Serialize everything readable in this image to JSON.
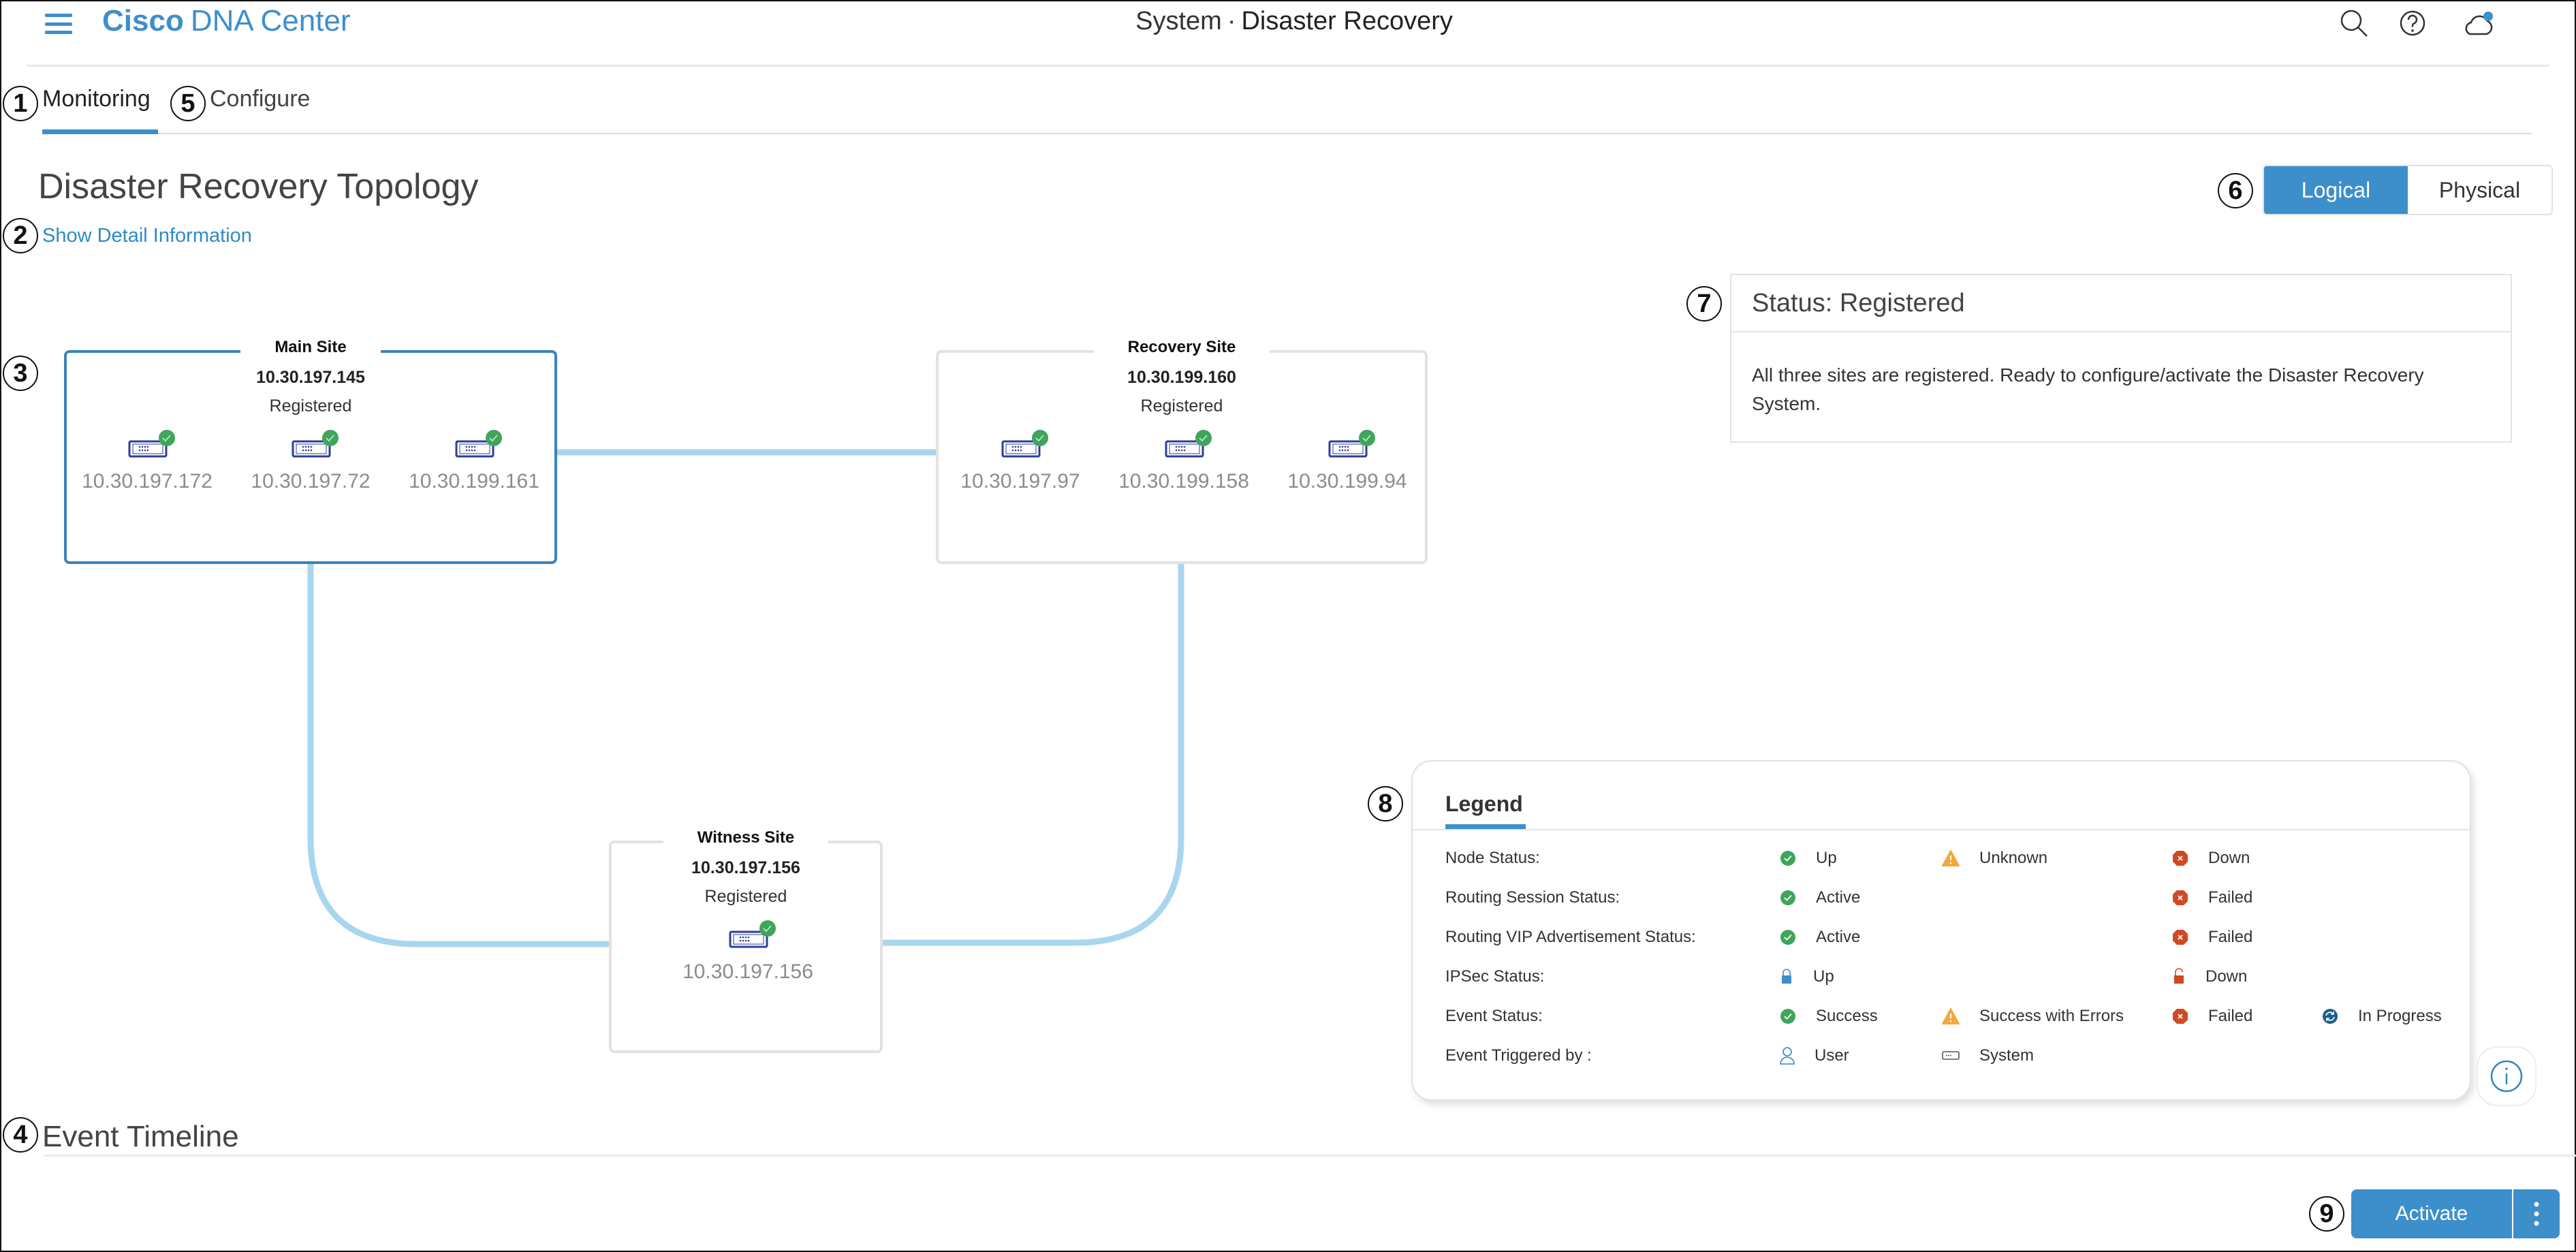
{
  "header": {
    "brand_bold": "Cisco",
    "brand_rest": "DNA Center",
    "title_section": "System",
    "title_separator": "·",
    "title_page": "Disaster Recovery",
    "icons": [
      "search-icon",
      "help-icon",
      "cloud-notification-icon"
    ]
  },
  "callouts": [
    "1",
    "2",
    "3",
    "4",
    "5",
    "6",
    "7",
    "8",
    "9"
  ],
  "tabs": [
    {
      "label": "Monitoring",
      "active": true
    },
    {
      "label": "Configure",
      "active": false
    }
  ],
  "topology": {
    "title": "Disaster Recovery Topology",
    "detail_link": "Show Detail Information",
    "view_toggle": {
      "options": [
        "Logical",
        "Physical"
      ],
      "selected": "Logical"
    },
    "sites": {
      "main": {
        "name": "Main Site",
        "vip": "10.30.197.145",
        "status": "Registered",
        "nodes": [
          {
            "ip": "10.30.197.172",
            "status": "up"
          },
          {
            "ip": "10.30.197.72",
            "status": "up"
          },
          {
            "ip": "10.30.199.161",
            "status": "up"
          }
        ]
      },
      "recovery": {
        "name": "Recovery Site",
        "vip": "10.30.199.160",
        "status": "Registered",
        "nodes": [
          {
            "ip": "10.30.197.97",
            "status": "up"
          },
          {
            "ip": "10.30.199.158",
            "status": "up"
          },
          {
            "ip": "10.30.199.94",
            "status": "up"
          }
        ]
      },
      "witness": {
        "name": "Witness Site",
        "vip": "10.30.197.156",
        "status": "Registered",
        "nodes": [
          {
            "ip": "10.30.197.156",
            "status": "up"
          }
        ]
      }
    }
  },
  "status_card": {
    "title": "Status: Registered",
    "message": "All three sites are registered. Ready to configure/activate the Disaster Recovery System."
  },
  "legend": {
    "title": "Legend",
    "rows": [
      {
        "label": "Node Status:",
        "items": [
          {
            "icon": "check-circle-icon",
            "text": "Up",
            "col": 0
          },
          {
            "icon": "warning-triangle-icon",
            "text": "Unknown",
            "col": 1
          },
          {
            "icon": "x-octagon-icon",
            "text": "Down",
            "col": 2
          }
        ]
      },
      {
        "label": "Routing Session Status:",
        "items": [
          {
            "icon": "check-circle-icon",
            "text": "Active",
            "col": 0
          },
          {
            "icon": "x-octagon-icon",
            "text": "Failed",
            "col": 2
          }
        ]
      },
      {
        "label": "Routing VIP Advertisement Status:",
        "items": [
          {
            "icon": "check-circle-icon",
            "text": "Active",
            "col": 0
          },
          {
            "icon": "x-octagon-icon",
            "text": "Failed",
            "col": 2
          }
        ]
      },
      {
        "label": "IPSec Status:",
        "items": [
          {
            "icon": "lock-closed-icon",
            "text": "Up",
            "col": 0
          },
          {
            "icon": "lock-open-icon",
            "text": "Down",
            "col": 2
          }
        ]
      },
      {
        "label": "Event Status:",
        "items": [
          {
            "icon": "check-circle-icon",
            "text": "Success",
            "col": 0
          },
          {
            "icon": "warning-triangle-icon",
            "text": "Success with Errors",
            "col": 1
          },
          {
            "icon": "x-octagon-icon",
            "text": "Failed",
            "col": 2
          },
          {
            "icon": "in-progress-icon",
            "text": "In Progress",
            "col": 3
          }
        ]
      },
      {
        "label": "Event Triggered by :",
        "items": [
          {
            "icon": "user-icon",
            "text": "User",
            "col": 0
          },
          {
            "icon": "system-icon",
            "text": "System",
            "col": 1
          }
        ]
      }
    ]
  },
  "event_timeline": {
    "title": "Event Timeline"
  },
  "actions": {
    "activate_label": "Activate",
    "more_icon": "more-vertical-icon"
  },
  "colors": {
    "accent": "#3d8fcb",
    "link_line": "#a9d6ee",
    "main_site_border": "#3a84b8",
    "up_green": "#3fa55b",
    "warning_orange": "#f2a93b",
    "error_red": "#cf4a24",
    "in_progress_blue": "#1d5e8c",
    "device_navy": "#2d3f96"
  }
}
